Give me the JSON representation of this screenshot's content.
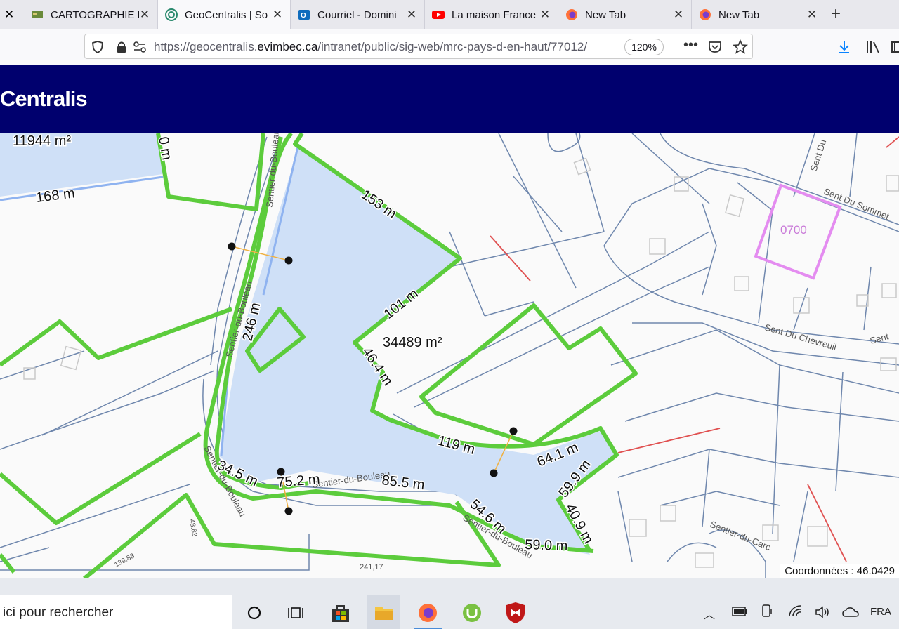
{
  "tabs": [
    {
      "title": "CARTOGRAPHIE E",
      "icon": "map-favicon-icon",
      "active": false
    },
    {
      "title": "GeoCentralis | So",
      "icon": "geocentralis-favicon-icon",
      "active": true
    },
    {
      "title": "Courriel - Domini",
      "icon": "outlook-favicon-icon",
      "active": false
    },
    {
      "title": "La maison France",
      "icon": "youtube-favicon-icon",
      "active": false
    },
    {
      "title": "New Tab",
      "icon": "firefox-favicon-icon",
      "active": false
    },
    {
      "title": "New Tab",
      "icon": "firefox-favicon-icon",
      "active": false
    }
  ],
  "nav": {
    "url_prefix": "https://geocentralis.",
    "url_domain": "evimbec.ca",
    "url_path": "/intranet/public/sig-web/mrc-pays-d-en-haut/77012/",
    "zoom": "120%"
  },
  "site": {
    "brand": "Centralis"
  },
  "map": {
    "labels": {
      "area1": "11944 m²",
      "area2": "34489 m²",
      "d0": "0 m",
      "d168": "168 m",
      "d153": "153 m",
      "d101": "101 m",
      "d246": "246 m",
      "d46": "46.4 m",
      "d119": "119 m",
      "d64": "64.1 m",
      "d599": "59.9 m",
      "d409": "40.9 m",
      "d590": "59.0 m",
      "d546": "54.6 m",
      "d855": "85.5 m",
      "d752": "75.2 m",
      "d345": "34.5 m",
      "lot": "0700",
      "st_sommet": "Sent Du Sommet",
      "st_chevreuil": "Sent Du Chevreuil",
      "st_bouleau_a": "Sentier-du-Bouleau",
      "st_bouleau_b": "Sentier-du-Bouleau",
      "st_bouleau_c": "Sentier-du-Bouleau",
      "st_bouleau_d": "Sentier-du-Bouleau",
      "st_carc": "Sentier-du-Carc",
      "st_sent": "Sent Du",
      "st_sent2": "Sent",
      "n1": "48.82",
      "n2": "139.83",
      "n3": "241,17"
    },
    "coords": "Coordonnées : 46.0429"
  },
  "taskbar": {
    "search_text": "ici pour rechercher",
    "lang": "FRA"
  },
  "colors": {
    "header_bg": "#00006e",
    "parcel_green": "#5ccc3c",
    "parcel_fill": "#cfe0f7",
    "lot_purple": "#e48cf0",
    "line_blue": "#6f87ad",
    "line_red": "#e05050"
  }
}
